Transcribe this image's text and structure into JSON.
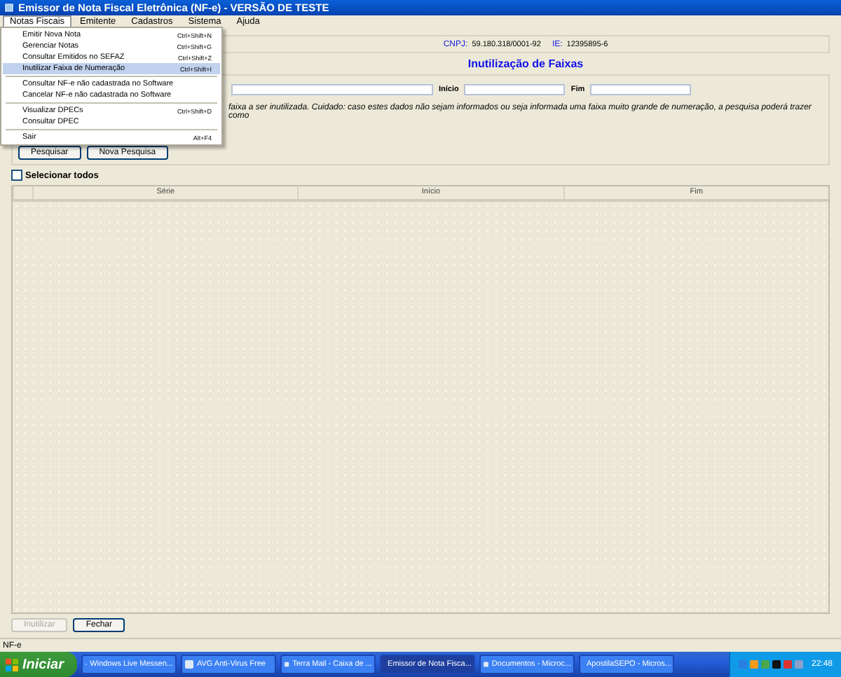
{
  "window": {
    "title": "Emissor de Nota Fiscal Eletrônica (NF-e) - VERSÃO DE TESTE"
  },
  "menubar": [
    {
      "label": "Notas Fiscais",
      "selected": true
    },
    {
      "label": "Emitente",
      "selected": false
    },
    {
      "label": "Cadastros",
      "selected": false
    },
    {
      "label": "Sistema",
      "selected": false
    },
    {
      "label": "Ajuda",
      "selected": false
    }
  ],
  "menu": [
    {
      "kind": "item",
      "label": "Emitir Nova Nota",
      "shortcut": "Ctrl+Shift+N",
      "selected": false
    },
    {
      "kind": "item",
      "label": "Gerenciar Notas",
      "shortcut": "Ctrl+Shift+G",
      "selected": false
    },
    {
      "kind": "item",
      "label": "Consultar Emitidos no SEFAZ",
      "shortcut": "Ctrl+Shift+Z",
      "selected": false
    },
    {
      "kind": "item",
      "label": "Inutilizar Faixa de Numeração",
      "shortcut": "Ctrl+Shift+I",
      "selected": true
    },
    {
      "kind": "separator"
    },
    {
      "kind": "item",
      "label": "Consultar NF-e não cadastrada no Software",
      "selected": false
    },
    {
      "kind": "item",
      "label": "Cancelar NF-e não cadastrada no Software",
      "selected": false
    },
    {
      "kind": "separator"
    },
    {
      "kind": "item",
      "label": "Visualizar DPECs",
      "shortcut": "Ctrl+Shift+D",
      "selected": false
    },
    {
      "kind": "item",
      "label": "Consultar DPEC",
      "selected": false
    },
    {
      "kind": "separator"
    },
    {
      "kind": "item",
      "label": "Sair",
      "shortcut": "Alt+F4",
      "selected": false
    }
  ],
  "header": {
    "cnpj_label": "CNPJ:",
    "cnpj": "59.180.318/0001-92",
    "ie_label": "IE:",
    "ie": "12395895-6"
  },
  "panel": {
    "title": "Inutilização de Faixas",
    "inicio_label": "Início",
    "fim_label": "Fim",
    "description": "faixa a ser inutilizada. Cuidado: caso estes dados não sejam informados ou seja informada uma faixa muito grande de numeração, a pesquisa poderá trazer como",
    "buttons": [
      "Pesquisar",
      "Nova Pesquisa"
    ]
  },
  "select_all": {
    "label": "Selecionar todos",
    "checked": false
  },
  "table": {
    "columns": [
      "Série",
      "Início",
      "Fim"
    ]
  },
  "footer_buttons": [
    {
      "label": "Inutilizar",
      "disabled": true
    },
    {
      "label": "Fechar",
      "disabled": false
    }
  ],
  "status_bar": "NF-e",
  "taskbar": {
    "start": "Iniciar",
    "items": [
      {
        "label": "Windows Live Messen...",
        "selected": false
      },
      {
        "label": "AVG Anti-Virus Free",
        "selected": false
      },
      {
        "label": "Terra Mail - Caixa de ...",
        "selected": false
      },
      {
        "label": "Emissor de Nota Fisca...",
        "selected": true
      },
      {
        "label": "Documentos - Microc...",
        "selected": false
      },
      {
        "label": "ApostilaSEPO - Micros...",
        "selected": false
      }
    ],
    "clock": "22:48"
  }
}
